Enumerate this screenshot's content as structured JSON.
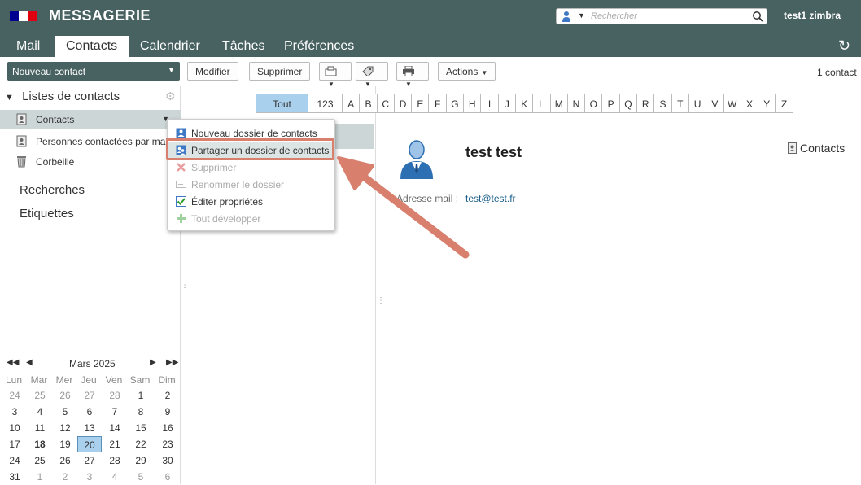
{
  "header": {
    "brand": "MESSAGERIE",
    "search_placeholder": "Rechercher",
    "user": "test1 zimbra",
    "flag_colors": [
      "#000091",
      "#ffffff",
      "#e1000f"
    ]
  },
  "tabs": [
    {
      "label": "Mail",
      "active": false
    },
    {
      "label": "Contacts",
      "active": true
    },
    {
      "label": "Calendrier",
      "active": false
    },
    {
      "label": "Tâches",
      "active": false
    },
    {
      "label": "Préférences",
      "active": false
    }
  ],
  "toolbar": {
    "new_contact": "Nouveau contact",
    "modify": "Modifier",
    "delete": "Supprimer",
    "actions": "Actions",
    "count": "1 contact"
  },
  "sidebar": {
    "lists_title": "Listes de contacts",
    "items": [
      {
        "label": "Contacts",
        "icon": "address-book-icon",
        "selected": true
      },
      {
        "label": "Personnes contactées par mail",
        "icon": "address-book-icon",
        "selected": false
      },
      {
        "label": "Corbeille",
        "icon": "trash-icon",
        "selected": false
      }
    ],
    "searches": "Recherches",
    "tags": "Etiquettes"
  },
  "calendar": {
    "title": "Mars 2025",
    "weekdays": [
      "Lun",
      "Mar",
      "Mer",
      "Jeu",
      "Ven",
      "Sam",
      "Dim"
    ],
    "weeks": [
      [
        "24",
        "25",
        "26",
        "27",
        "28",
        "1",
        "2"
      ],
      [
        "3",
        "4",
        "5",
        "6",
        "7",
        "8",
        "9"
      ],
      [
        "10",
        "11",
        "12",
        "13",
        "14",
        "15",
        "16"
      ],
      [
        "17",
        "18",
        "19",
        "20",
        "21",
        "22",
        "23"
      ],
      [
        "24",
        "25",
        "26",
        "27",
        "28",
        "29",
        "30"
      ],
      [
        "31",
        "1",
        "2",
        "3",
        "4",
        "5",
        "6"
      ]
    ],
    "today": "20",
    "bold_day": "18"
  },
  "alpha": [
    "Tout",
    "123",
    "A",
    "B",
    "C",
    "D",
    "E",
    "F",
    "G",
    "H",
    "I",
    "J",
    "K",
    "L",
    "M",
    "N",
    "O",
    "P",
    "Q",
    "R",
    "S",
    "T",
    "U",
    "V",
    "W",
    "X",
    "Y",
    "Z"
  ],
  "context_menu": [
    {
      "label": "Nouveau dossier de contacts",
      "enabled": true,
      "icon": "new-folder-icon"
    },
    {
      "label": "Partager un dossier de contacts",
      "enabled": true,
      "icon": "share-folder-icon",
      "highlighted": true
    },
    {
      "label": "Supprimer",
      "enabled": false,
      "icon": "delete-x-icon"
    },
    {
      "label": "Renommer le dossier",
      "enabled": false,
      "icon": "rename-icon"
    },
    {
      "label": "Éditer propriétés",
      "enabled": true,
      "icon": "edit-properties-icon"
    },
    {
      "label": "Tout développer",
      "enabled": false,
      "icon": "expand-all-icon"
    }
  ],
  "contact": {
    "name": "test test",
    "folder": "Contacts",
    "email_label": "Adresse mail :",
    "email": "test@test.fr"
  },
  "colors": {
    "header": "#486161",
    "selection": "#ccd6d6",
    "today": "#a9d0ec",
    "annotation": "#d97f6e"
  }
}
